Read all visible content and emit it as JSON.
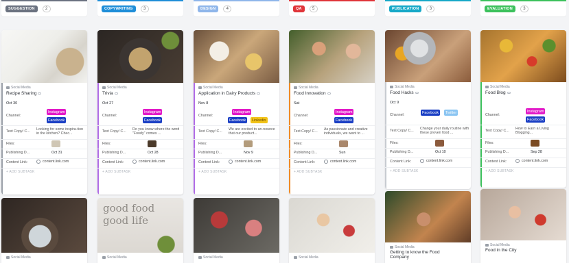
{
  "columns": [
    {
      "status": "SUGGESTION",
      "count": "2",
      "color": "#6b7280"
    },
    {
      "status": "COPYWRITING",
      "count": "3",
      "color": "#1f8ed8"
    },
    {
      "status": "DESIGN",
      "count": "4",
      "color": "#8fb6ea"
    },
    {
      "status": "QA",
      "count": "5",
      "color": "#e0353a"
    },
    {
      "status": "PUBLICATION",
      "count": "3",
      "color": "#17a9c8"
    },
    {
      "status": "EVALUATION",
      "count": "3",
      "color": "#3cc15c"
    }
  ],
  "labels": {
    "list": "Social Media",
    "channel": "Channel:",
    "text_copy": "Text Copy/ C...",
    "files": "Files:",
    "publishing": "Publishing D...",
    "content_link": "Content Link:",
    "add_subtask": "+ ADD SUBTASK",
    "link_value": "content.link.com"
  },
  "cards": [
    {
      "title": "Recipe Sharing",
      "date": "Oct 30",
      "tags": [
        "Instagram",
        "Facebook"
      ],
      "copy": "Looking for some inspira-tion in the kitchen? Chec...",
      "publish": "Oct 31"
    },
    {
      "title": "Trivia",
      "date": "Oct 27",
      "tags": [
        "Instagram",
        "Facebook"
      ],
      "copy": "Do you know where the word \"Foody\" comes ...",
      "publish": "Oct 28"
    },
    {
      "title": "Application in Dairy Products",
      "date": "Nov 8",
      "tags": [
        "Instagram",
        "Facebook",
        "Linkedin"
      ],
      "copy": "We are excited to an-nounce that our product...",
      "publish": "Nov 9"
    },
    {
      "title": "Food Innovation",
      "date": "Sat",
      "tags": [
        "Instagram",
        "Facebook"
      ],
      "copy": "As passionate and creative individuals, we want to ...",
      "publish": "Sun"
    },
    {
      "title": "Food Hacks",
      "date": "Oct 9",
      "tags": [
        "Facebook",
        "Twitter"
      ],
      "copy": "Change your daily routine with these proven food ...",
      "publish": "Oct 10"
    },
    {
      "title": "Food Blog",
      "date": "",
      "tags": [
        "Instagram",
        "Facebook"
      ],
      "copy": "How to Earn a Living Blogging...",
      "publish": "Sep 28"
    }
  ],
  "bottom_cards": [
    {
      "title": "",
      "overlay_text": ""
    },
    {
      "title": "",
      "overlay_text": "good food good life"
    },
    {
      "title": "",
      "overlay_text": ""
    },
    {
      "title": "",
      "overlay_text": ""
    },
    {
      "title": "Getting to know the Food Company",
      "overlay_text": ""
    },
    {
      "title": "Food in the City",
      "overlay_text": ""
    }
  ],
  "tag_colors": {
    "Instagram": "#e21bc8",
    "Facebook": "#1a3fc4",
    "Linkedin": "#f2c318",
    "Twitter": "#8bc5f2"
  },
  "accent_colors": [
    "#9aa0a8",
    "#b06be6",
    "#b06be6",
    "#f08a24",
    "#c7cbd1",
    "#3cc15c"
  ]
}
